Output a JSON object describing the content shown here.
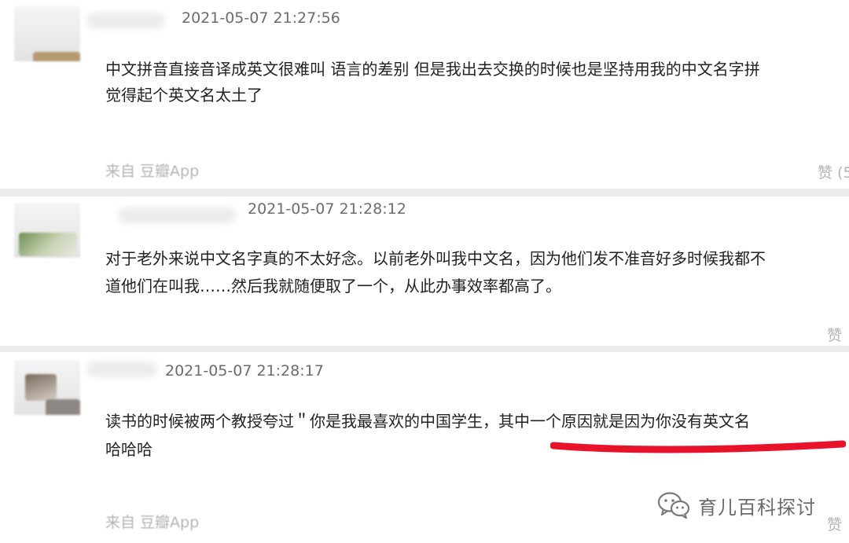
{
  "comments": [
    {
      "timestamp": "2021-05-07 21:27:56",
      "lines": [
        "中文拼音直接音译成英文很难叫 语言的差别 但是我出去交换的时候也是坚持用我的中文名字拼",
        "觉得起个英文名太土了"
      ],
      "source": "来自 豆瓣App",
      "like": "赞 (5"
    },
    {
      "timestamp": "2021-05-07 21:28:12",
      "lines": [
        "对于老外来说中文名字真的不太好念。以前老外叫我中文名，因为他们发不准音好多时候我都不",
        "道他们在叫我……然后我就随便取了一个，从此办事效率都高了。"
      ],
      "source": "",
      "like": "赞"
    },
    {
      "timestamp": "2021-05-07 21:28:17",
      "lines": [
        "读书的时候被两个教授夸过＂你是我最喜欢的中国学生，其中一个原因就是因为你没有英文名",
        "哈哈哈"
      ],
      "source": "来自 豆瓣App",
      "like": "赞"
    }
  ],
  "watermark": {
    "text": "育儿百科探讨",
    "icon": "wechat-icon"
  },
  "colors": {
    "highlight": "#e8132b",
    "meta": "#b4b4b4",
    "text": "#222222"
  }
}
